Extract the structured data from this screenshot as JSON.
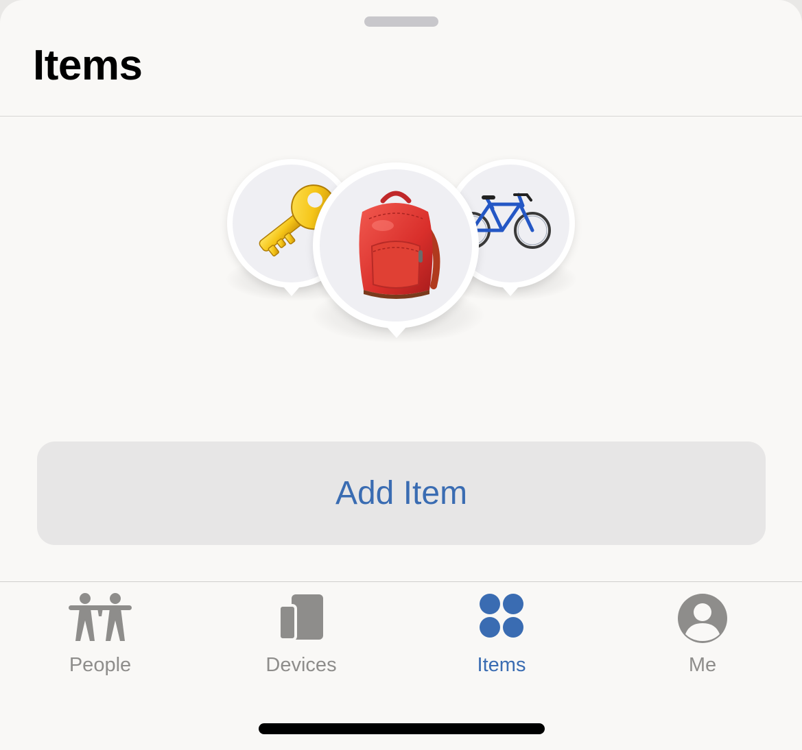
{
  "header": {
    "title": "Items"
  },
  "illustration": {
    "pins": [
      {
        "name": "key",
        "icon": "key-icon"
      },
      {
        "name": "backpack",
        "icon": "backpack-icon"
      },
      {
        "name": "bicycle",
        "icon": "bicycle-icon"
      }
    ]
  },
  "actions": {
    "add_item_label": "Add Item"
  },
  "tabbar": {
    "tabs": [
      {
        "label": "People",
        "icon": "people-icon",
        "active": false
      },
      {
        "label": "Devices",
        "icon": "devices-icon",
        "active": false
      },
      {
        "label": "Items",
        "icon": "items-icon",
        "active": true
      },
      {
        "label": "Me",
        "icon": "me-icon",
        "active": false
      }
    ]
  },
  "colors": {
    "accent": "#3a6cb2",
    "inactive": "#8e8d8b",
    "background": "#f9f8f6",
    "button_bg": "#e7e6e6"
  }
}
